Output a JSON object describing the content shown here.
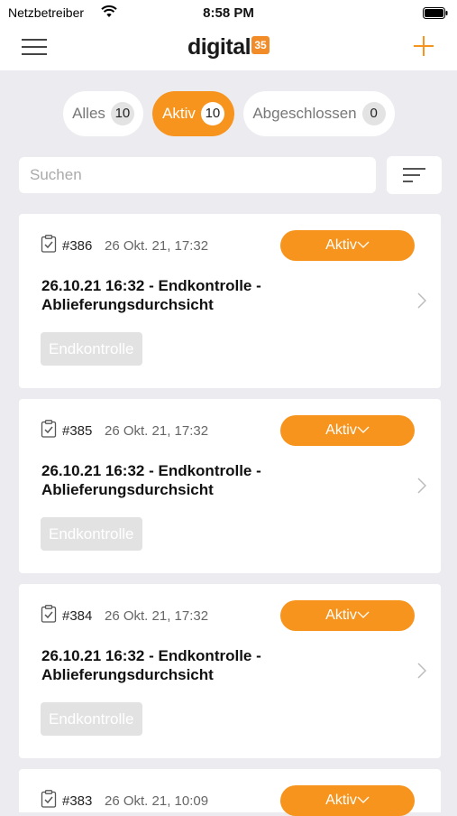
{
  "status_bar": {
    "carrier": "Netzbetreiber",
    "time": "8:58 PM"
  },
  "nav": {
    "logo_text": "digital",
    "logo_badge": "35",
    "accent": "#f7941d"
  },
  "segments": [
    {
      "label": "Alles",
      "count": "10",
      "active": false
    },
    {
      "label": "Aktiv",
      "count": "10",
      "active": true
    },
    {
      "label": "Abgeschlossen",
      "count": "0",
      "active": false
    }
  ],
  "search": {
    "placeholder": "Suchen"
  },
  "cards": [
    {
      "number": "#386",
      "date": "26 Okt. 21, 17:32",
      "status": "Aktiv",
      "title": "26.10.21 16:32 - Endkontrolle - Ablieferungsdurchsicht",
      "tag": "Endkontrolle"
    },
    {
      "number": "#385",
      "date": "26 Okt. 21, 17:32",
      "status": "Aktiv",
      "title": "26.10.21 16:32 - Endkontrolle - Ablieferungsdurchsicht",
      "tag": "Endkontrolle"
    },
    {
      "number": "#384",
      "date": "26 Okt. 21, 17:32",
      "status": "Aktiv",
      "title": "26.10.21 16:32 - Endkontrolle - Ablieferungsdurchsicht",
      "tag": "Endkontrolle"
    },
    {
      "number": "#383",
      "date": "26 Okt. 21, 10:09",
      "status": "Aktiv",
      "title": "",
      "tag": ""
    }
  ]
}
